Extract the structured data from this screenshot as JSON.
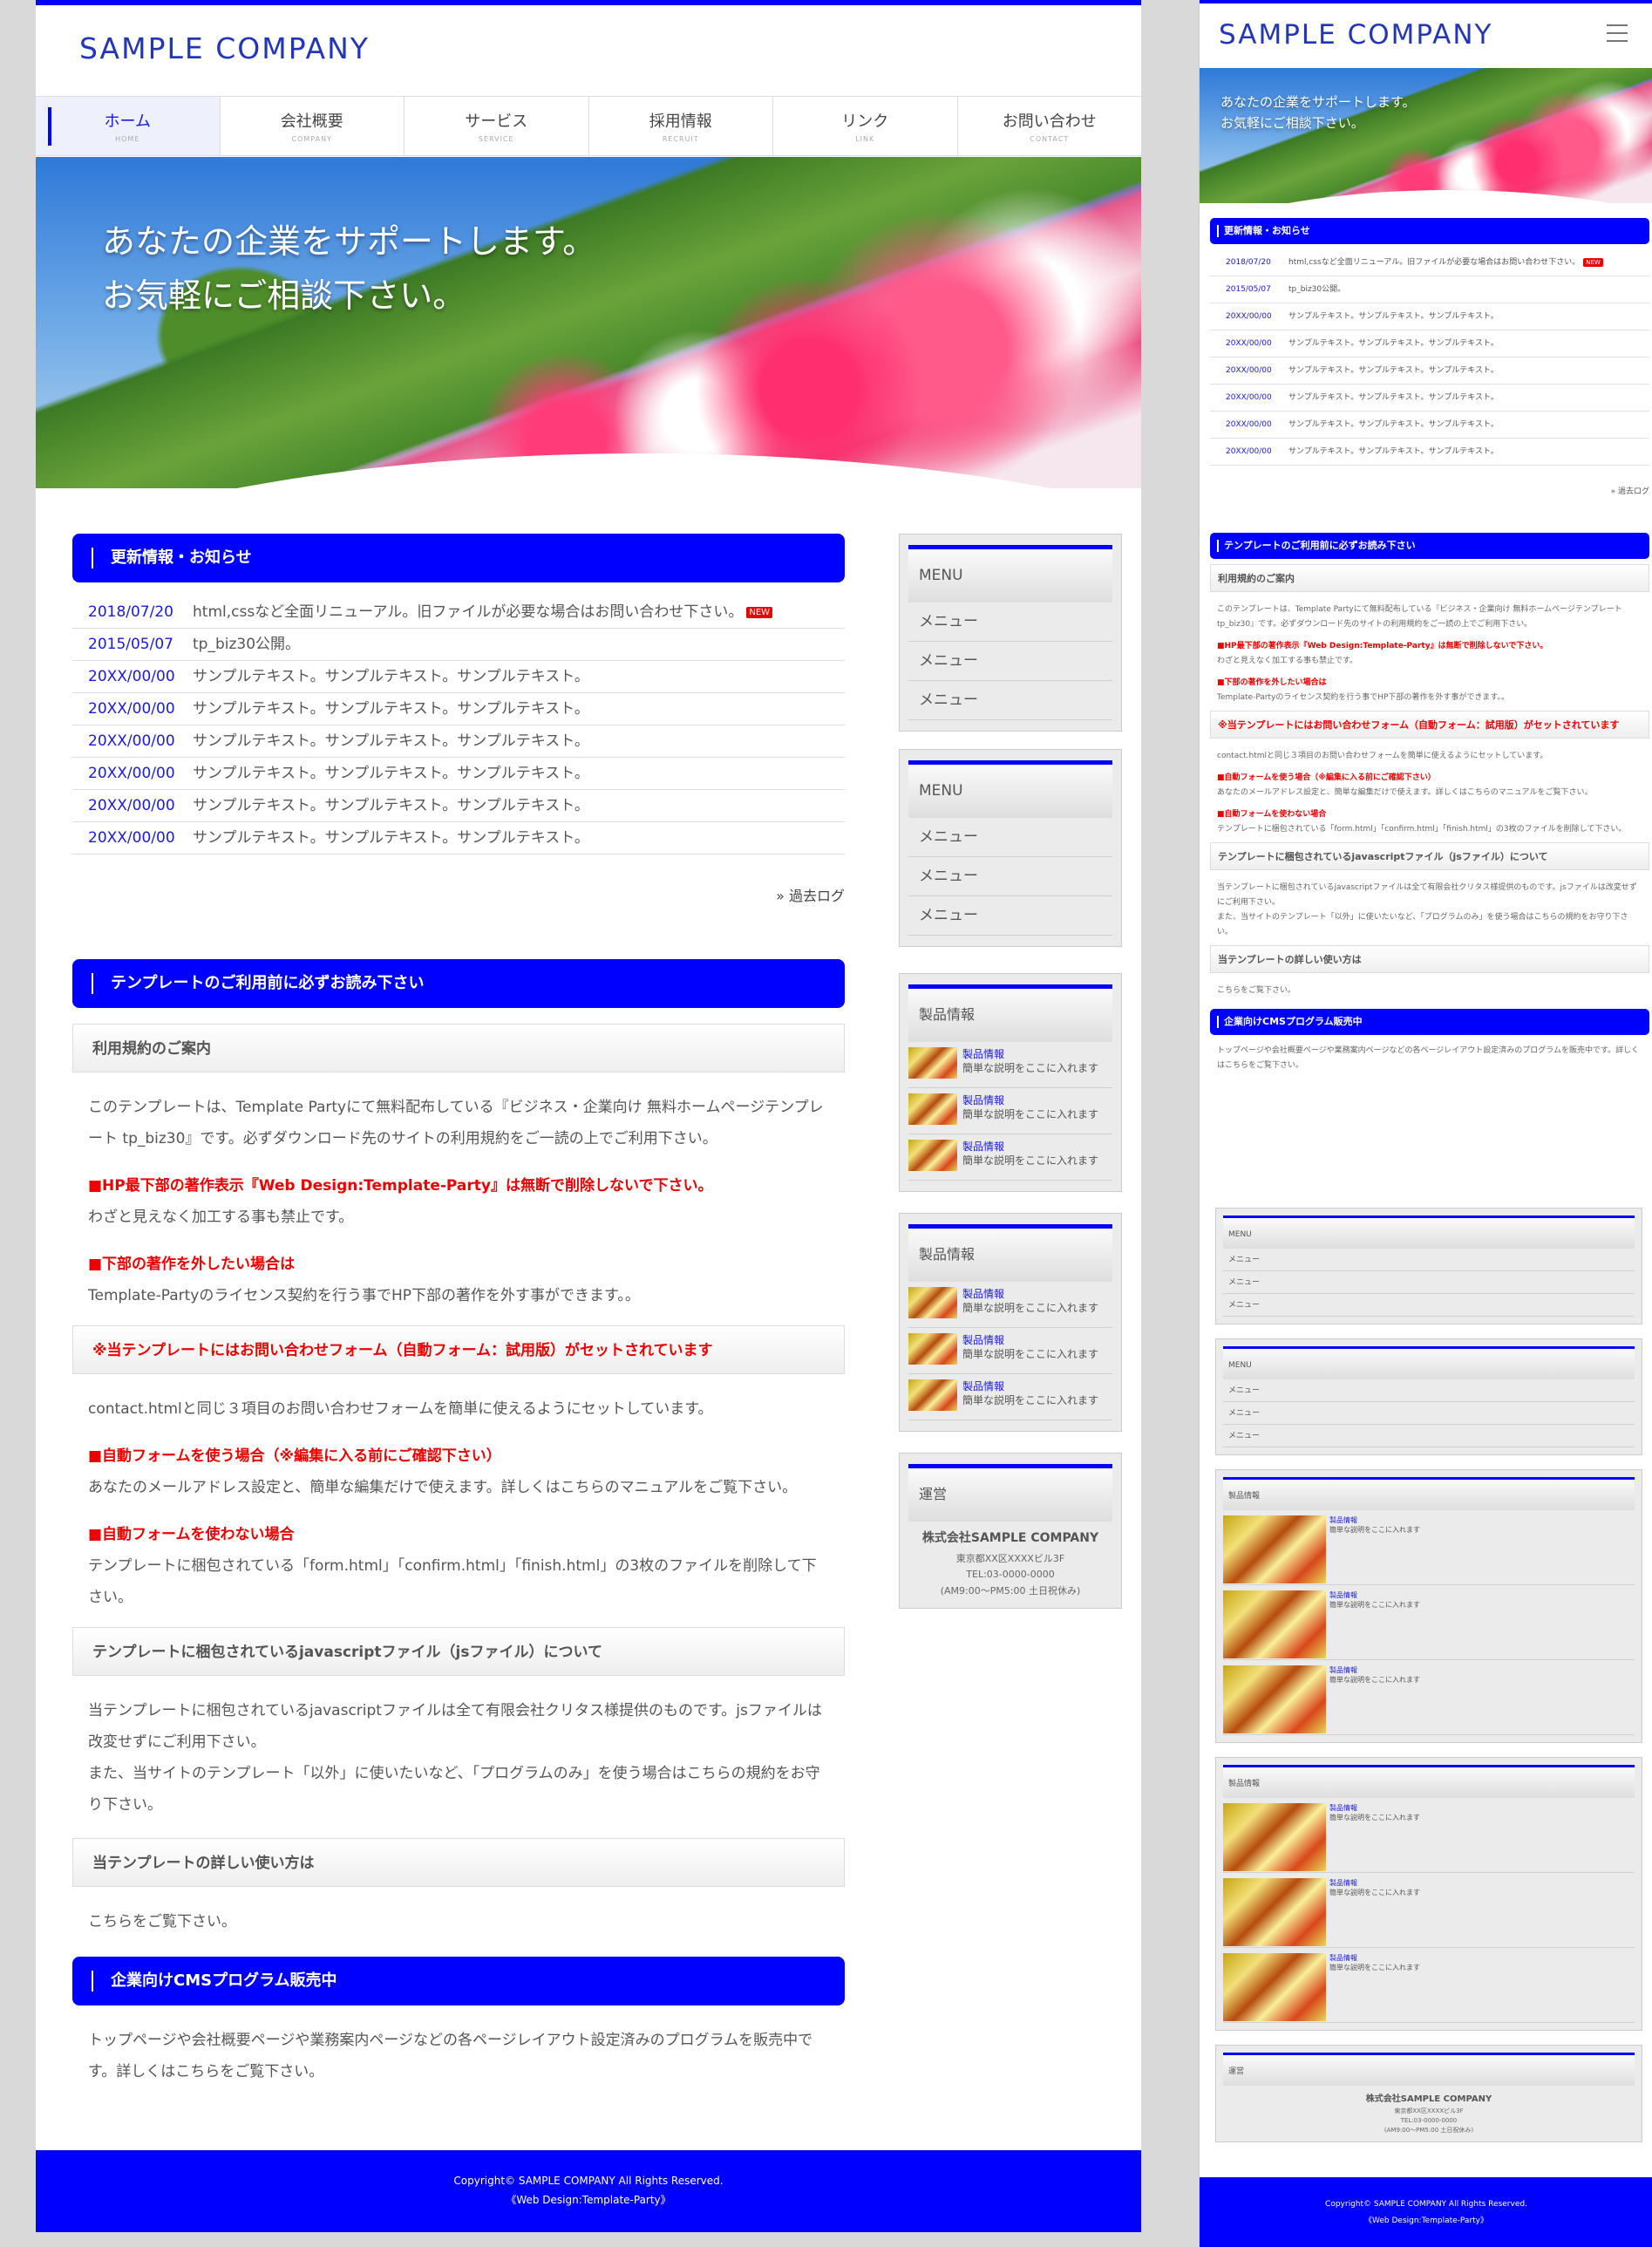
{
  "site": {
    "logo": "SAMPLE COMPANY",
    "catch_line1": "あなたの企業をサポートします。",
    "catch_line2": "お気軽にご相談下さい。"
  },
  "nav": [
    {
      "jp": "ホーム",
      "en": "HOME"
    },
    {
      "jp": "会社概要",
      "en": "COMPANY"
    },
    {
      "jp": "サービス",
      "en": "SERVICE"
    },
    {
      "jp": "採用情報",
      "en": "RECRUIT"
    },
    {
      "jp": "リンク",
      "en": "LINK"
    },
    {
      "jp": "お問い合わせ",
      "en": "CONTACT"
    }
  ],
  "news": {
    "title": "更新情報・お知らせ",
    "new_badge": "NEW",
    "items": [
      {
        "date": "2018/07/20",
        "text": "html,cssなど全面リニューアル。旧ファイルが必要な場合はお問い合わせ下さい。"
      },
      {
        "date": "2015/05/07",
        "text": "tp_biz30公開。"
      },
      {
        "date": "20XX/00/00",
        "text": "サンプルテキスト。サンプルテキスト。サンプルテキスト。"
      },
      {
        "date": "20XX/00/00",
        "text": "サンプルテキスト。サンプルテキスト。サンプルテキスト。"
      },
      {
        "date": "20XX/00/00",
        "text": "サンプルテキスト。サンプルテキスト。サンプルテキスト。"
      },
      {
        "date": "20XX/00/00",
        "text": "サンプルテキスト。サンプルテキスト。サンプルテキスト。"
      },
      {
        "date": "20XX/00/00",
        "text": "サンプルテキスト。サンプルテキスト。サンプルテキスト。"
      },
      {
        "date": "20XX/00/00",
        "text": "サンプルテキスト。サンプルテキスト。サンプルテキスト。"
      }
    ],
    "past_log": "» 過去ログ"
  },
  "guide": {
    "title": "テンプレートのご利用前に必ずお読み下さい",
    "terms_h": "利用規約のご案内",
    "terms_p": "このテンプレートは、Template Partyにて無料配布している『ビジネス・企業向け 無料ホームページテンプレート tp_biz30』です。必ずダウンロード先のサイトの利用規約をご一読の上でご利用下さい。",
    "credit_h": "■HP最下部の著作表示『Web Design:Template-Party』は無断で削除しないで下さい。",
    "credit_p": "わざと見えなく加工する事も禁止です。",
    "remove_h": "■下部の著作を外したい場合は",
    "remove_p": "Template-Partyのライセンス契約を行う事でHP下部の著作を外す事ができます。。",
    "form_h": "※当テンプレートにはお問い合わせフォーム（自動フォーム：試用版）がセットされています",
    "form_p": "contact.htmlと同じ３項目のお問い合わせフォームを簡単に使えるようにセットしています。",
    "use_h": "■自動フォームを使う場合（※編集に入る前にご確認下さい）",
    "use_p": "あなたのメールアドレス設定と、簡単な編集だけで使えます。詳しくはこちらのマニュアルをご覧下さい。",
    "nouse_h": "■自動フォームを使わない場合",
    "nouse_p": "テンプレートに梱包されている「form.html」「confirm.html」「finish.html」の3枚のファイルを削除して下さい。",
    "js_h": "テンプレートに梱包されているjavascriptファイル（jsファイル）について",
    "js_p1": "当テンプレートに梱包されているjavascriptファイルは全て有限会社クリタス様提供のものです。jsファイルは改変せずにご利用下さい。",
    "js_p2": "また、当サイトのテンプレート「以外」に使いたいなど、「プログラムのみ」を使う場合はこちらの規約をお守り下さい。",
    "howto_h": "当テンプレートの詳しい使い方は",
    "howto_p": "こちらをご覧下さい。"
  },
  "cms": {
    "title": "企業向けCMSプログラム販売中",
    "text": "トップページや会社概要ページや業務案内ページなどの各ページレイアウト設定済みのプログラムを販売中です。詳しくはこちらをご覧下さい。"
  },
  "sidebar": {
    "menu_title": "MENU",
    "menu_item": "メニュー",
    "products_title": "製品情報",
    "product_name": "製品情報",
    "product_desc": "簡単な説明をここに入れます",
    "company_title": "運営",
    "company_name": "株式会社SAMPLE COMPANY",
    "company_addr": "東京都XX区XXXXビル3F",
    "company_tel": "TEL:03-0000-0000",
    "company_hours": "(AM9:00～PM5:00 土日祝休み)"
  },
  "footer": {
    "copyright": "Copyright© SAMPLE COMPANY All Rights Reserved.",
    "credit": "《Web Design:Template-Party》"
  },
  "colors": {
    "accent": "#0000ff",
    "link": "#1a1adb",
    "warning": "#e00000",
    "side_bg": "#ebebeb"
  },
  "icons": {
    "menu": "hamburger-menu-icon",
    "new": "new-badge"
  }
}
